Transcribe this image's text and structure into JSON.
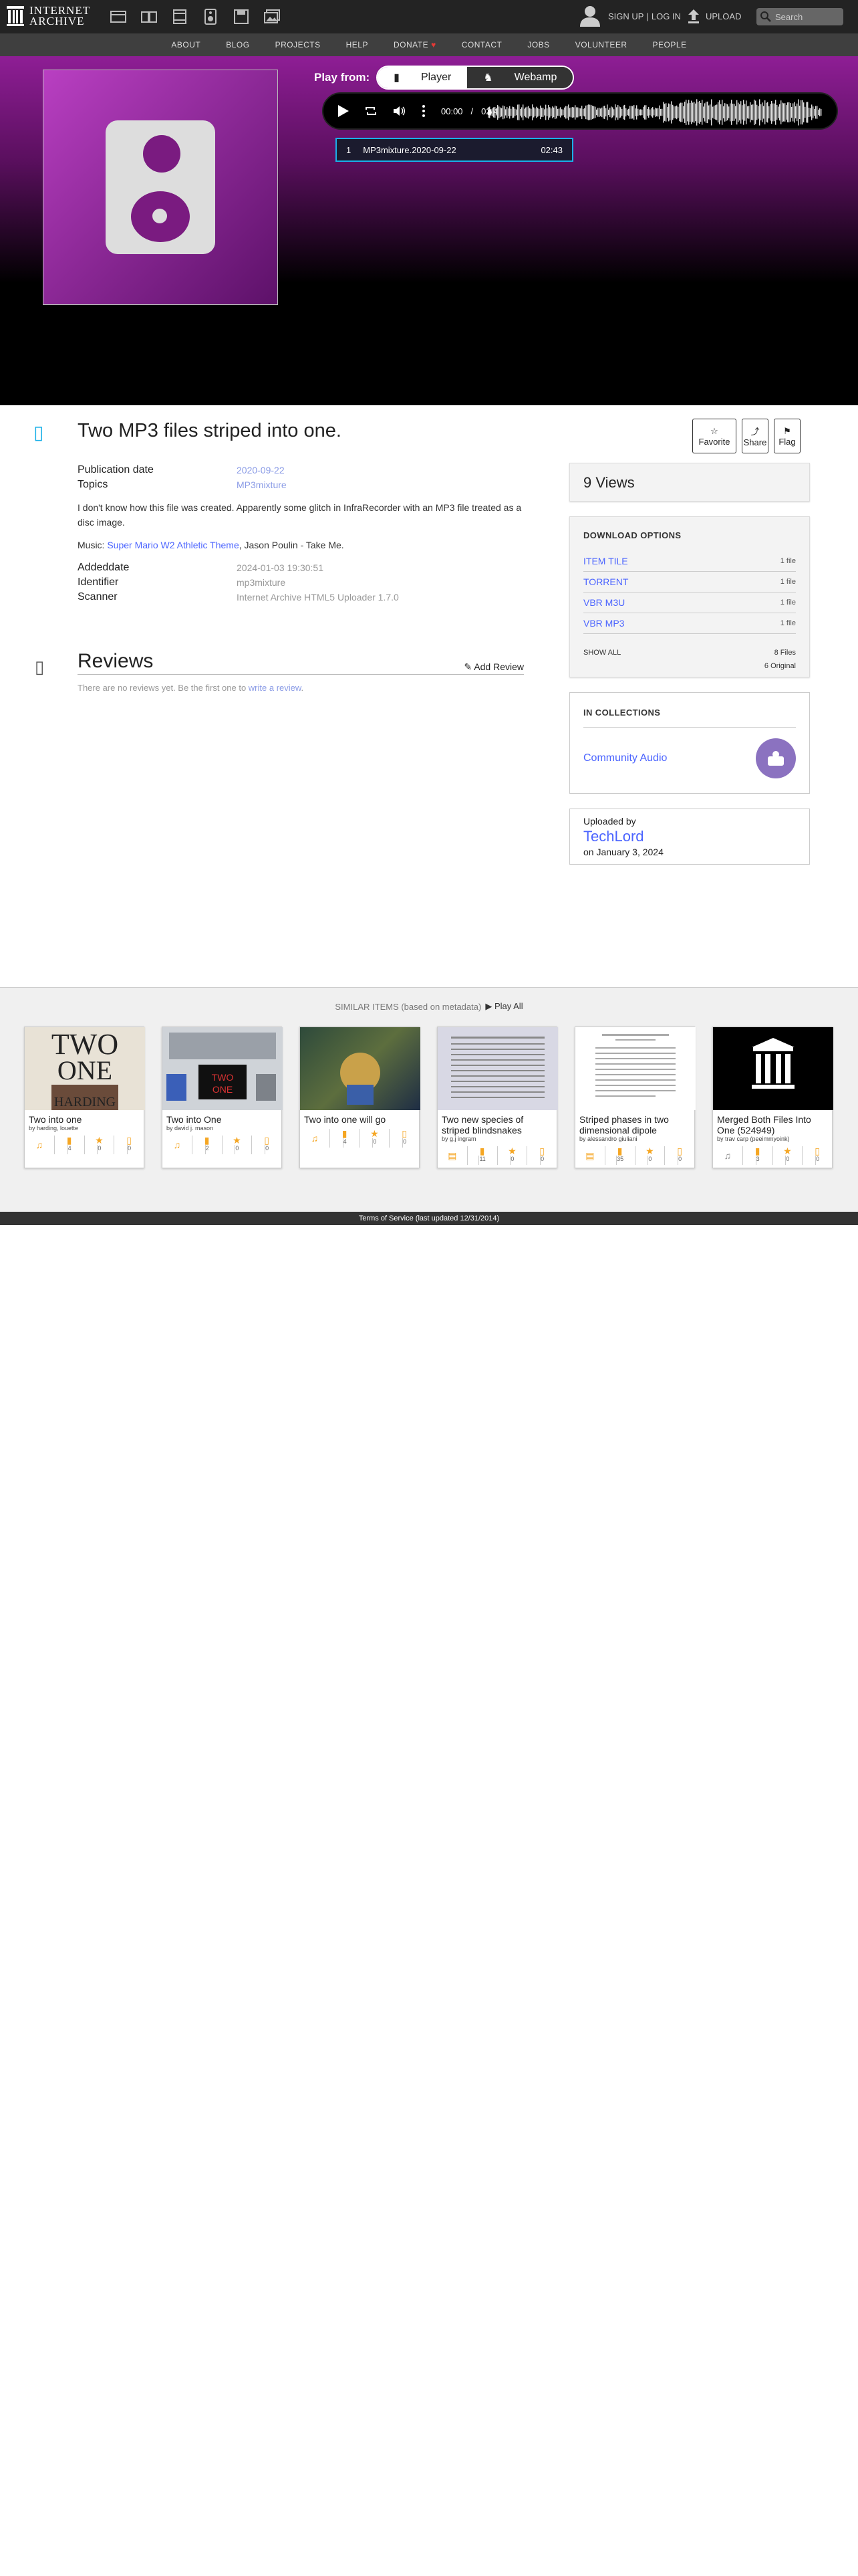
{
  "topnav": {
    "logo_line1": "INTERNET",
    "logo_line2": "ARCHIVE",
    "signup": "SIGN UP",
    "separator": "|",
    "login": "LOG IN",
    "upload": "UPLOAD",
    "search_placeholder": "Search"
  },
  "subnav": {
    "items": [
      "ABOUT",
      "BLOG",
      "PROJECTS",
      "HELP",
      "DONATE",
      "CONTACT",
      "JOBS",
      "VOLUNTEER",
      "PEOPLE"
    ],
    "donate_heart_color": "#e53935"
  },
  "theater": {
    "play_from": "Play from:",
    "player_label": "Player",
    "webamp_label": "Webamp",
    "time_current": "00:00",
    "time_sep": "/",
    "time_total": "02:4",
    "track_number": "1",
    "track_title": "MP3mixture.2020-09-22",
    "track_duration": "02:43",
    "accent_color": "#1ab0e8"
  },
  "item": {
    "title": "Two MP3 files striped into one.",
    "favorite": "Favorite",
    "share": "Share",
    "flag": "Flag",
    "pubdate_label": "Publication date",
    "pubdate_value": "2020-09-22",
    "topics_label": "Topics",
    "topics_value": "MP3mixture",
    "description": "I don't know how this file was created. Apparently some glitch in InfraRecorder with an MP3 file treated as a disc image.",
    "music_prefix": "Music: ",
    "music_link": "Super Mario W2 Athletic Theme",
    "music_suffix": ", Jason Poulin - Take Me.",
    "addeddate_label": "Addeddate",
    "addeddate_value": "2024-01-03 19:30:51",
    "identifier_label": "Identifier",
    "identifier_value": "mp3mixture",
    "scanner_label": "Scanner",
    "scanner_value": "Internet Archive HTML5 Uploader 1.7.0"
  },
  "reviews": {
    "heading": "Reviews",
    "add": "Add Review",
    "empty_prefix": "There are no reviews yet. Be the first one to ",
    "empty_link": "write a review",
    "empty_suffix": "."
  },
  "sidebar": {
    "views": "9 Views",
    "download_heading": "DOWNLOAD OPTIONS",
    "downloads": [
      {
        "label": "ITEM TILE",
        "count": "1 file"
      },
      {
        "label": "TORRENT",
        "count": "1 file"
      },
      {
        "label": "VBR M3U",
        "count": "1 file"
      },
      {
        "label": "VBR MP3",
        "count": "1 file"
      }
    ],
    "show_all": "SHOW ALL",
    "files_total": "8 Files",
    "original_total": "6 Original",
    "collections_heading": "IN COLLECTIONS",
    "collection_name": "Community Audio",
    "uploaded_by": "Uploaded by",
    "uploader": "TechLord",
    "upload_date": "on January 3, 2024"
  },
  "similar": {
    "heading": "SIMILAR ITEMS (based on metadata)",
    "play_all": "Play All",
    "cards": [
      {
        "title": "Two into one",
        "by": "by harding, louette",
        "views": "4",
        "favs": "0",
        "reviews": "0"
      },
      {
        "title": "Two into One",
        "by": "by david j. mason",
        "views": "2",
        "favs": "0",
        "reviews": "0"
      },
      {
        "title": "Two into one will go",
        "by": "",
        "views": "4",
        "favs": "0",
        "reviews": "0"
      },
      {
        "title": "Two new species of striped blindsnakes",
        "by": "by g.j ingram",
        "views": "11",
        "favs": "0",
        "reviews": "0"
      },
      {
        "title": "Striped phases in two dimensional dipole",
        "by": "by alessandro giuliani",
        "views": "35",
        "favs": "0",
        "reviews": "0"
      },
      {
        "title": "Merged Both Files Into One (524949)",
        "by": "by trav carp (peeimmyoink)",
        "views": "3",
        "favs": "0",
        "reviews": "0"
      }
    ]
  },
  "footer": {
    "text": "Terms of Service (last updated 12/31/2014)"
  }
}
